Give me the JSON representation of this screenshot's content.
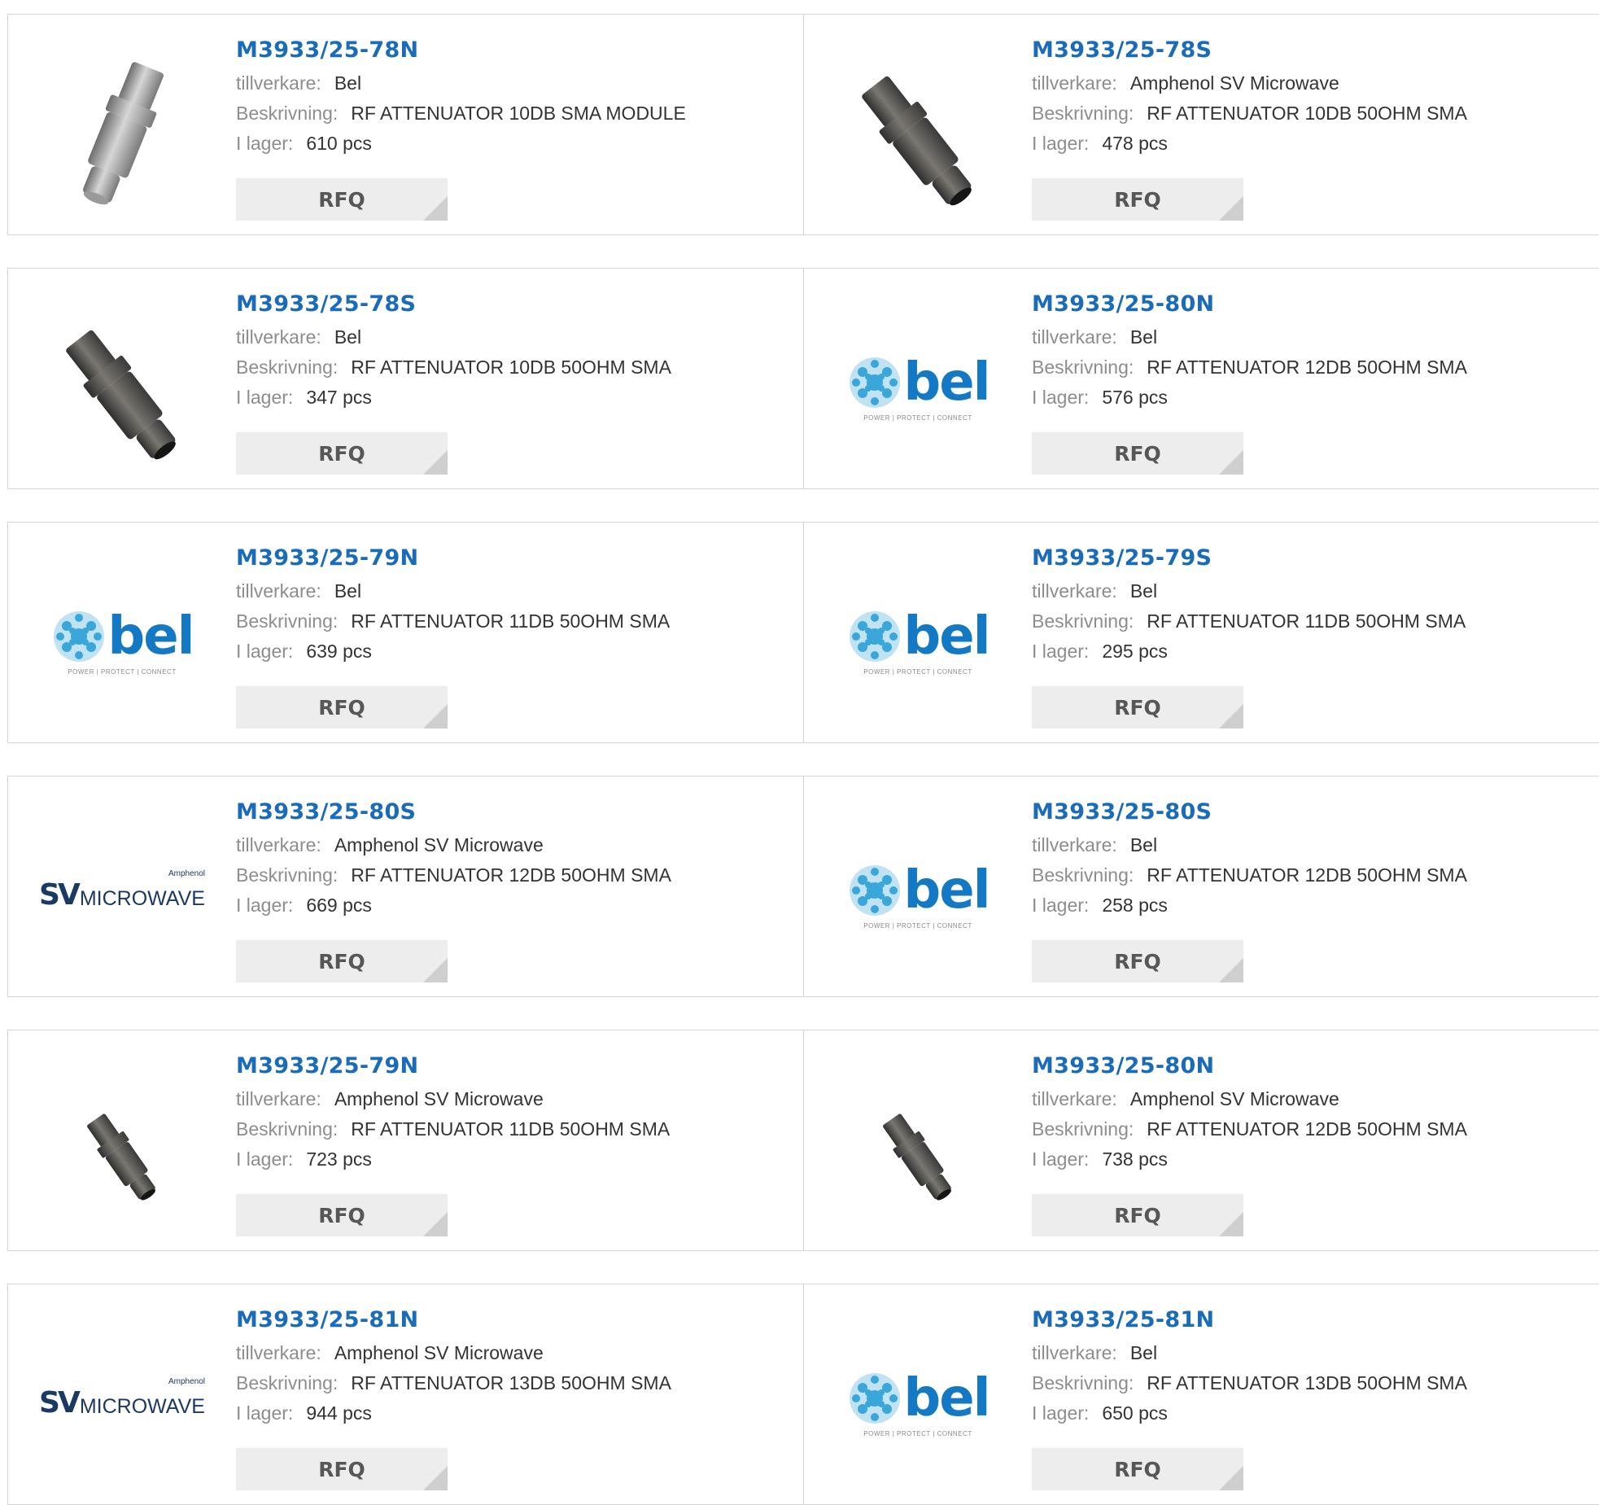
{
  "labels": {
    "manufacturer": "tillverkare:",
    "description": "Beskrivning:",
    "stock": "I lager:",
    "rfq": "RFQ"
  },
  "logo_text": {
    "bel": "bel",
    "bel_tagline": "POWER | PROTECT | CONNECT",
    "sv": "SV",
    "microwave": "MICROWAVE",
    "amphenol": "Amphenol"
  },
  "colors": {
    "part_number": "#1a6bb8",
    "bel_blue": "#1479c4",
    "sv_navy": "#1a3a63"
  },
  "products": [
    {
      "part": "M3933/25-78N",
      "manufacturer": "Bel",
      "description": "RF ATTENUATOR 10DB SMA MODULE",
      "stock": "610 pcs",
      "image": "attenuator-silver"
    },
    {
      "part": "M3933/25-78S",
      "manufacturer": "Amphenol SV Microwave",
      "description": "RF ATTENUATOR 10DB 50OHM SMA",
      "stock": "478 pcs",
      "image": "attenuator-dark"
    },
    {
      "part": "M3933/25-78S",
      "manufacturer": "Bel",
      "description": "RF ATTENUATOR 10DB 50OHM SMA",
      "stock": "347 pcs",
      "image": "attenuator-dark"
    },
    {
      "part": "M3933/25-80N",
      "manufacturer": "Bel",
      "description": "RF ATTENUATOR 12DB 50OHM SMA",
      "stock": "576 pcs",
      "image": "bel-logo"
    },
    {
      "part": "M3933/25-79N",
      "manufacturer": "Bel",
      "description": "RF ATTENUATOR 11DB 50OHM SMA",
      "stock": "639 pcs",
      "image": "bel-logo"
    },
    {
      "part": "M3933/25-79S",
      "manufacturer": "Bel",
      "description": "RF ATTENUATOR 11DB 50OHM SMA",
      "stock": "295 pcs",
      "image": "bel-logo"
    },
    {
      "part": "M3933/25-80S",
      "manufacturer": "Amphenol SV Microwave",
      "description": "RF ATTENUATOR 12DB 50OHM SMA",
      "stock": "669 pcs",
      "image": "sv-microwave-logo"
    },
    {
      "part": "M3933/25-80S",
      "manufacturer": "Bel",
      "description": "RF ATTENUATOR 12DB 50OHM SMA",
      "stock": "258 pcs",
      "image": "bel-logo"
    },
    {
      "part": "M3933/25-79N",
      "manufacturer": "Amphenol SV Microwave",
      "description": "RF ATTENUATOR 11DB 50OHM SMA",
      "stock": "723 pcs",
      "image": "attenuator-small"
    },
    {
      "part": "M3933/25-80N",
      "manufacturer": "Amphenol SV Microwave",
      "description": "RF ATTENUATOR 12DB 50OHM SMA",
      "stock": "738 pcs",
      "image": "attenuator-small"
    },
    {
      "part": "M3933/25-81N",
      "manufacturer": "Amphenol SV Microwave",
      "description": "RF ATTENUATOR 13DB 50OHM SMA",
      "stock": "944 pcs",
      "image": "sv-microwave-logo"
    },
    {
      "part": "M3933/25-81N",
      "manufacturer": "Bel",
      "description": "RF ATTENUATOR 13DB 50OHM SMA",
      "stock": "650 pcs",
      "image": "bel-logo"
    }
  ]
}
